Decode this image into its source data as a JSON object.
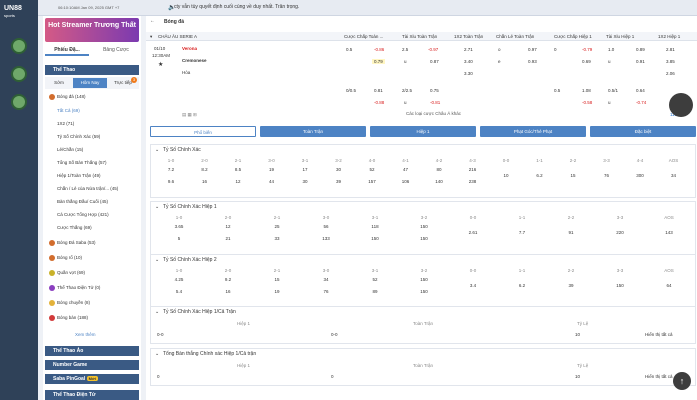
{
  "brand": {
    "logo": "UN88",
    "logo_sub": "sports"
  },
  "topbar": {
    "time": "06:10:10AM Jan 09, 2025 GMT +7",
    "marquee": "cty vẫn tùy quyết định cuối cùng về duy nhất. Trân trọng."
  },
  "sidebar": {
    "banner": "Hot Streamer Trương Thất",
    "tabs": [
      "Phiếu Đặ...",
      "Bảng Cược"
    ],
    "bars": [
      "Thể Thao",
      "Thể Thao Ảo",
      "Number Game",
      "Saba PinGoal",
      "Thể Thao Điện Tử"
    ],
    "subtabs": [
      "Sớm",
      "Hôm Nay",
      "Trực tiếp"
    ],
    "subtab_badge": "3",
    "sports": [
      {
        "label": "Bóng đá (148)"
      },
      {
        "label": "Tất Cả (69)"
      },
      {
        "label": "1X2 (71)"
      },
      {
        "label": "Tỷ Số Chính Xác (59)"
      },
      {
        "label": "Lẻ/Chẵn (15)"
      },
      {
        "label": "Tổng Số Bàn Thắng (57)"
      },
      {
        "label": "Hiệp 1/Toàn Trận (49)"
      },
      {
        "label": "Chẵn / Lẻ của Nửa trận/... (45)"
      },
      {
        "label": "Bàn thắng Đầu/ Cuối (45)"
      },
      {
        "label": "Cá Cược Tổng Hợp (421)"
      },
      {
        "label": "Cược Thắng (69)"
      },
      {
        "label": "Bóng Đá Saba (53)"
      },
      {
        "label": "Bóng rổ (10)"
      },
      {
        "label": "Quần vợt (69)"
      },
      {
        "label": "Thể Thao Điện Tử (0)"
      },
      {
        "label": "Bóng chuyền (8)"
      },
      {
        "label": "Bóng bàn (188)"
      },
      {
        "label": "Xem thêm"
      }
    ],
    "pingoal_badge": "Mới"
  },
  "league": "Bóng đá",
  "league_sub": "CHÂU ÂU SERIE A",
  "match": {
    "date": "01/10",
    "time": "12:30AM",
    "home": "Verona",
    "away": "Cremonese",
    "draw": "Hòa"
  },
  "columns": [
    "Cược Chấp Toàn ...",
    "Tài Xỉu Toàn Trận",
    "1X2 Toàn Trận",
    "Chẵn Lẻ Toàn Trận",
    "Cược Chấp Hiệp 1",
    "Tài Xỉu Hiệp 1",
    "1X2 Hiệp 1"
  ],
  "odds_row1": [
    "0.5",
    "-0.86",
    "2.5",
    "-0.97",
    "2.71",
    "o",
    "0.97",
    "0",
    "-0.79",
    "1.0",
    "0.89",
    "2.81"
  ],
  "odds_row2": [
    "0.79",
    "u",
    "0.87",
    "3.40",
    "e",
    "0.93",
    "0.69",
    "u",
    "0.91",
    "3.85"
  ],
  "odds_row3": [
    "3.30",
    "2.06"
  ],
  "odds_row4": [
    "0/0.5",
    "0.81",
    "2/2.5",
    "0.75",
    "0.5",
    "1.08",
    "0.5/1",
    "0.64"
  ],
  "odds_row5": [
    "-0.88",
    "u",
    "-0.81",
    "-0.58",
    "u",
    "-0.74"
  ],
  "more": "Các loại cược Châu Á khác",
  "tabs": [
    "Phổ biến",
    "Toàn Trận",
    "Hiệp 1",
    "Phạt Góc/Thẻ Phạt",
    "Đặc biệt"
  ],
  "more_count": "119",
  "cs_labels": [
    "1-0",
    "2-0",
    "2-1",
    "3-0",
    "3-1",
    "3-2",
    "4-0",
    "4-1",
    "4-2",
    "4-3",
    "0-0",
    "1-1",
    "2-2",
    "3-3",
    "4-4",
    "AOS"
  ],
  "sec1": {
    "title": "Tỷ Số Chính Xác",
    "home": [
      "7.2",
      "8.2",
      "8.5",
      "19",
      "17",
      "30",
      "52",
      "47",
      "80",
      "216"
    ],
    "draw": [
      "10",
      "6.2",
      "15",
      "76",
      "300",
      "34"
    ],
    "away": [
      "9.6",
      "16",
      "12",
      "44",
      "30",
      "39",
      "157",
      "106",
      "140",
      "238"
    ]
  },
  "sec2": {
    "title": "Tỷ Số Chính Xác Hiệp 1",
    "labels": [
      "1-0",
      "2-0",
      "2-1",
      "3-0",
      "3-1",
      "3-2",
      "0-0",
      "1-1",
      "2-2",
      "3-3",
      "AOS"
    ],
    "home": [
      "3.65",
      "12",
      "25",
      "56",
      "118",
      "150"
    ],
    "draw": [
      "2.61",
      "7.7",
      "91",
      "220",
      "143"
    ],
    "away": [
      "5",
      "21",
      "33",
      "133",
      "150",
      "150"
    ]
  },
  "sec3": {
    "title": "Tỷ Số Chính Xác Hiệp 2",
    "labels": [
      "1-0",
      "2-0",
      "2-1",
      "3-0",
      "3-1",
      "3-2",
      "0-0",
      "1-1",
      "2-2",
      "3-3",
      "AOS"
    ],
    "home": [
      "4.25",
      "9.2",
      "15",
      "34",
      "52",
      "150"
    ],
    "draw": [
      "3.4",
      "6.2",
      "39",
      "150",
      "64"
    ],
    "away": [
      "5.4",
      "16",
      "19",
      "76",
      "89",
      "150"
    ]
  },
  "sec4": {
    "title": "Tỷ Số Chính Xác Hiệp 1/Cả Trận",
    "cols": [
      "Hiệp 1",
      "Toàn Trận",
      "Tỷ Lệ"
    ],
    "row": [
      "0-0",
      "0-0",
      "10"
    ],
    "showall": "Hiển thị tất cả"
  },
  "sec5": {
    "title": "Tổng Bàn thắng Chính xác Hiệp 1/Cả trận",
    "cols": [
      "Hiệp 1",
      "Toàn Trận",
      "Tỷ Lệ"
    ],
    "row": [
      "0",
      "0",
      "10"
    ],
    "showall": "Hiển thị tất cả"
  },
  "colors": {
    "accent": "#4d83c4",
    "nav": "#3a5a84",
    "odds_negative": "#d81b1b",
    "highlight": "#fff6c2"
  }
}
